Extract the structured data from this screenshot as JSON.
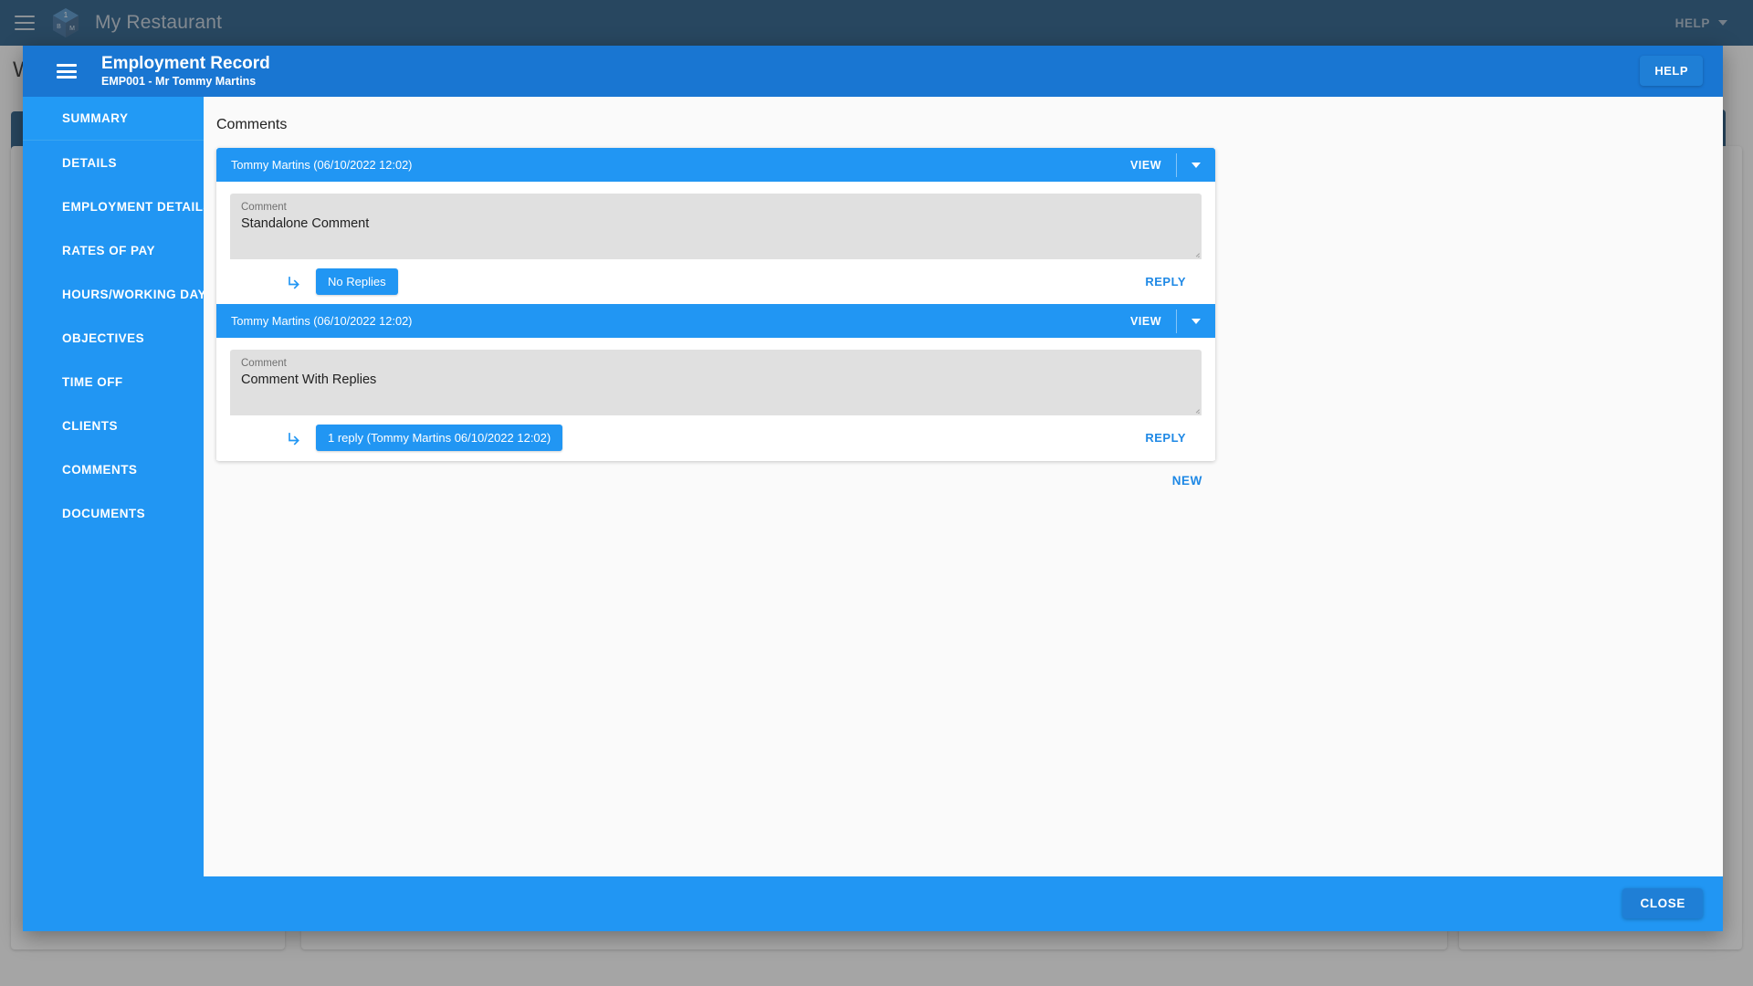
{
  "app": {
    "title": "My Restaurant",
    "help_label": "HELP",
    "logo_faces": {
      "top": "1",
      "left": "B",
      "right": "M"
    },
    "background_page_title": "W"
  },
  "dialog": {
    "title": "Employment Record",
    "subtitle": "EMP001 - Mr Tommy Martins",
    "help_label": "HELP",
    "close_label": "CLOSE",
    "sidebar": {
      "items": [
        {
          "label": "SUMMARY",
          "selected": true
        },
        {
          "label": "DETAILS",
          "selected": false
        },
        {
          "label": "EMPLOYMENT DETAILS",
          "selected": false
        },
        {
          "label": "RATES OF PAY",
          "selected": false
        },
        {
          "label": "HOURS/WORKING DAYS",
          "selected": false
        },
        {
          "label": "OBJECTIVES",
          "selected": false
        },
        {
          "label": "TIME OFF",
          "selected": false
        },
        {
          "label": "CLIENTS",
          "selected": false
        },
        {
          "label": "COMMENTS",
          "selected": false
        },
        {
          "label": "DOCUMENTS",
          "selected": false
        }
      ]
    },
    "content": {
      "heading": "Comments",
      "view_label": "VIEW",
      "comment_field_label": "Comment",
      "reply_link_label": "REPLY",
      "new_label": "NEW",
      "comments": [
        {
          "author_line": "Tommy Martins (06/10/2022 12:02)",
          "field_label": "Comment",
          "text": "Standalone Comment",
          "replies_chip": "No Replies",
          "reply_label": "REPLY"
        },
        {
          "author_line": "Tommy Martins (06/10/2022 12:02)",
          "field_label": "Comment",
          "text": "Comment With Replies",
          "replies_chip": "1 reply (Tommy Martins 06/10/2022 12:02)",
          "reply_label": "REPLY"
        }
      ]
    }
  },
  "colors": {
    "app_bar": "#0f4878",
    "dialog_header": "#1976d2",
    "sidebar": "#2196f3",
    "accent": "#2196f3",
    "link": "#1e88e5",
    "field_bg": "#e0e0e0"
  }
}
